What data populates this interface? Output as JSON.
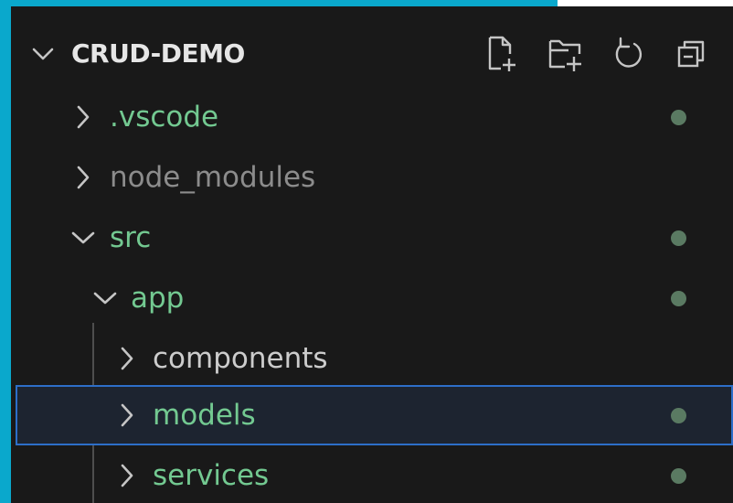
{
  "explorer": {
    "title": "CRUD-DEMO",
    "actions": [
      {
        "name": "new-file-button",
        "icon": "new-file-icon"
      },
      {
        "name": "new-folder-button",
        "icon": "new-folder-icon"
      },
      {
        "name": "refresh-explorer-button",
        "icon": "refresh-icon"
      },
      {
        "name": "collapse-folders-button",
        "icon": "collapse-all-icon"
      }
    ],
    "tree": [
      {
        "label": ".vscode",
        "expanded": false,
        "depth": 0,
        "status": "modified",
        "color": "#73c991"
      },
      {
        "label": "node_modules",
        "expanded": false,
        "depth": 0,
        "status": "ignored",
        "color": "#8c8c8c"
      },
      {
        "label": "src",
        "expanded": true,
        "depth": 0,
        "status": "modified",
        "color": "#73c991"
      },
      {
        "label": "app",
        "expanded": true,
        "depth": 1,
        "status": "modified",
        "color": "#73c991"
      },
      {
        "label": "components",
        "expanded": false,
        "depth": 2,
        "status": "none",
        "color": "#cccccc"
      },
      {
        "label": "models",
        "expanded": false,
        "depth": 2,
        "status": "modified",
        "color": "#73c991",
        "selected": true
      },
      {
        "label": "services",
        "expanded": false,
        "depth": 2,
        "status": "modified",
        "color": "#73c991"
      }
    ]
  },
  "colors": {
    "frame_accent": "#0aa8cc",
    "background": "#191919",
    "selection_border": "#2d6ec8",
    "git_dot": "#5a7a62",
    "icon": "#c5c5c5"
  }
}
